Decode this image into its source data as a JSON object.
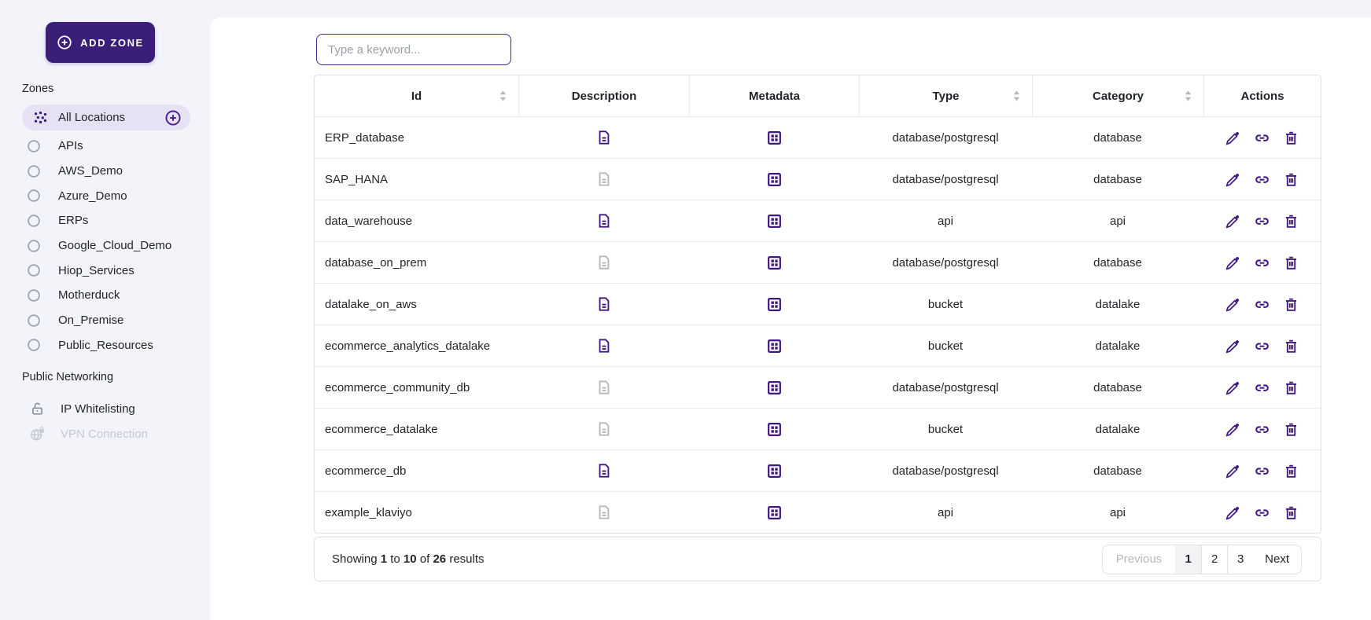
{
  "sidebar": {
    "add_zone_label": "ADD ZONE",
    "zones_section_label": "Zones",
    "selected_zone": {
      "label": "All Locations",
      "icon": "dots-cluster-icon",
      "action_icon": "plus-circle-icon"
    },
    "zones": [
      "APIs",
      "AWS_Demo",
      "Azure_Demo",
      "ERPs",
      "Google_Cloud_Demo",
      "Hiop_Services",
      "Motherduck",
      "On_Premise",
      "Public_Resources"
    ],
    "networking_section_label": "Public Networking",
    "networking_items": [
      {
        "label": "IP Whitelisting",
        "icon": "unlock-icon",
        "disabled": false
      },
      {
        "label": "VPN Connection",
        "icon": "globe-lock-icon",
        "disabled": true
      }
    ]
  },
  "search": {
    "placeholder": "Type a keyword..."
  },
  "table": {
    "columns": [
      {
        "label": "Id",
        "sortable": true
      },
      {
        "label": "Description",
        "sortable": false
      },
      {
        "label": "Metadata",
        "sortable": false
      },
      {
        "label": "Type",
        "sortable": true
      },
      {
        "label": "Category",
        "sortable": true
      },
      {
        "label": "Actions",
        "sortable": false
      }
    ],
    "row_icons": {
      "description": "document-icon",
      "metadata": "grid-icon",
      "actions": [
        "pencil-icon",
        "link-icon",
        "trash-icon"
      ]
    },
    "rows": [
      {
        "id": "ERP_database",
        "has_description": true,
        "has_metadata": true,
        "type": "database/postgresql",
        "category": "database"
      },
      {
        "id": "SAP_HANA",
        "has_description": false,
        "has_metadata": true,
        "type": "database/postgresql",
        "category": "database"
      },
      {
        "id": "data_warehouse",
        "has_description": true,
        "has_metadata": true,
        "type": "api",
        "category": "api"
      },
      {
        "id": "database_on_prem",
        "has_description": false,
        "has_metadata": true,
        "type": "database/postgresql",
        "category": "database"
      },
      {
        "id": "datalake_on_aws",
        "has_description": true,
        "has_metadata": true,
        "type": "bucket",
        "category": "datalake"
      },
      {
        "id": "ecommerce_analytics_datalake",
        "has_description": true,
        "has_metadata": true,
        "type": "bucket",
        "category": "datalake"
      },
      {
        "id": "ecommerce_community_db",
        "has_description": false,
        "has_metadata": true,
        "type": "database/postgresql",
        "category": "database"
      },
      {
        "id": "ecommerce_datalake",
        "has_description": false,
        "has_metadata": true,
        "type": "bucket",
        "category": "datalake"
      },
      {
        "id": "ecommerce_db",
        "has_description": true,
        "has_metadata": true,
        "type": "database/postgresql",
        "category": "database"
      },
      {
        "id": "example_klaviyo",
        "has_description": false,
        "has_metadata": true,
        "type": "api",
        "category": "api"
      }
    ]
  },
  "pagination": {
    "summary": {
      "prefix": "Showing",
      "from": "1",
      "to_word": "to",
      "to": "10",
      "of_word": "of",
      "total": "26",
      "suffix": "results"
    },
    "previous_label": "Previous",
    "pages": [
      "1",
      "2",
      "3"
    ],
    "active_page": "1",
    "next_label": "Next"
  },
  "colors": {
    "accent_purple": "#41187f",
    "button_purple": "#3b1e78",
    "selected_pill_bg": "#e6e2f4",
    "border_gray": "#dee2e6",
    "muted_gray": "#b4b9bf",
    "page_bg": "#f3f4fa"
  }
}
